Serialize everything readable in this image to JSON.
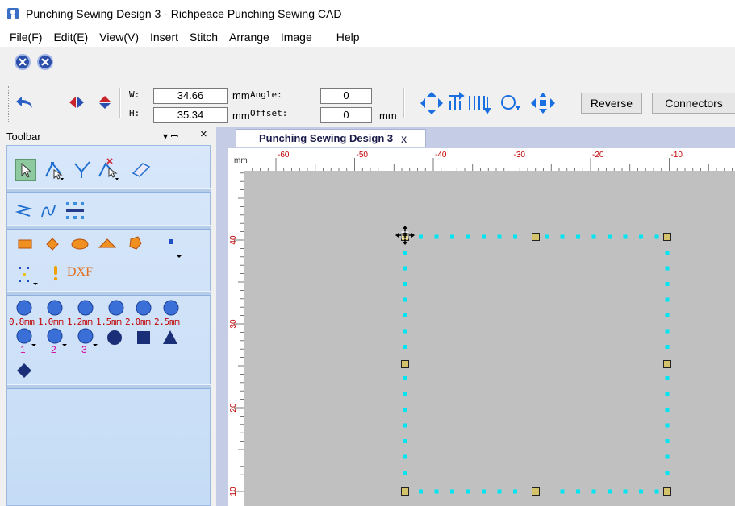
{
  "window": {
    "title": "Punching Sewing Design 3 - Richpeace Punching Sewing CAD"
  },
  "menu": [
    "File(F)",
    "Edit(E)",
    "View(V)",
    "Insert",
    "Stitch",
    "Arrange",
    "Image",
    "Help"
  ],
  "toolbar": {
    "w_label": "W:",
    "h_label": "H:",
    "width_value": "34.66",
    "height_value": "35.34",
    "unit_mm": "mm",
    "angle_label": "Angle:",
    "offset_label": "Offset:",
    "angle_value": "0",
    "offset_value": "0",
    "reverse_label": "Reverse",
    "connectors_label": "Connectors"
  },
  "left_panel": {
    "title": "Toolbar",
    "pin": "▾ ꟷ",
    "close": "×",
    "dxf_label": "DXF",
    "punch_sizes": [
      "0.8mm",
      "1.0mm",
      "1.2mm",
      "1.5mm",
      "2.0mm",
      "2.5mm"
    ],
    "punch_numbers": [
      "1",
      "2",
      "3"
    ]
  },
  "document": {
    "tab_title": "Punching Sewing Design 3",
    "tab_close": "x",
    "ruler_unit": "mm",
    "h_ticks": [
      "-60",
      "-50",
      "-40",
      "-30",
      "-20",
      "-10"
    ],
    "v_ticks": [
      "40",
      "30",
      "20",
      "10"
    ]
  },
  "colors": {
    "accent_blue": "#2b4ea8",
    "panel_bg": "#d0e2f8",
    "canvas_bg": "#c0c0c0",
    "stitch_cyan": "#00e5f0",
    "node_fill": "#d4c36a",
    "ruler_red": "#c00000"
  }
}
